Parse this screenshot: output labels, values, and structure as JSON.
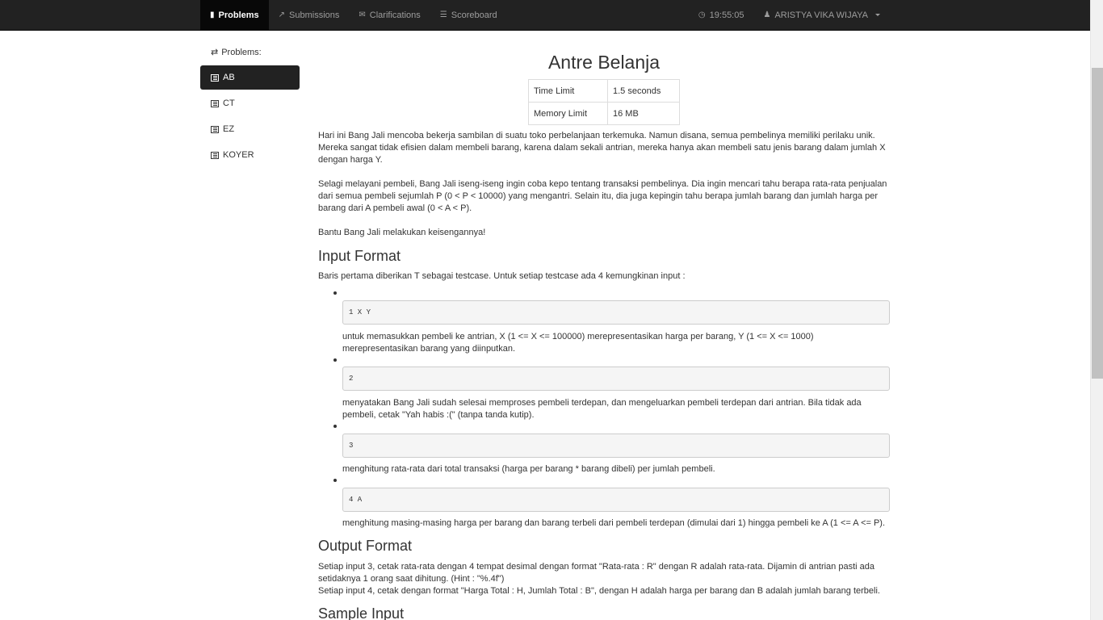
{
  "nav": {
    "items": [
      {
        "label": "Problems",
        "icon": "book-icon"
      },
      {
        "label": "Submissions",
        "icon": "share-icon"
      },
      {
        "label": "Clarifications",
        "icon": "envelope-icon"
      },
      {
        "label": "Scoreboard",
        "icon": "list-icon"
      }
    ],
    "clock": "19:55:05",
    "user": "ARISTYA VIKA WIJAYA"
  },
  "sidebar": {
    "heading": "Problems:",
    "items": [
      "AB",
      "CT",
      "EZ",
      "KOYER"
    ]
  },
  "problem": {
    "title": "Antre Belanja",
    "limits": [
      {
        "label": "Time Limit",
        "value": "1.5 seconds"
      },
      {
        "label": "Memory Limit",
        "value": "16 MB"
      }
    ],
    "p1": "Hari ini Bang Jali mencoba bekerja sambilan di suatu toko perbelanjaan terkemuka. Namun disana, semua pembelinya memiliki perilaku unik. Mereka sangat tidak efisien dalam membeli barang, karena dalam sekali antrian, mereka hanya akan membeli satu jenis barang dalam jumlah X dengan harga Y.",
    "p2": "Selagi melayani pembeli, Bang Jali iseng-iseng ingin coba kepo tentang transaksi pembelinya. Dia ingin mencari tahu berapa rata-rata penjualan dari semua pembeli sejumlah P (0 < P < 10000) yang mengantri. Selain itu, dia juga kepingin tahu berapa jumlah barang dan jumlah harga per barang dari A pembeli awal (0 < A < P).",
    "p3": "Bantu Bang Jali melakukan keisengannya!",
    "input_heading": "Input Format",
    "input_intro": "Baris pertama diberikan T sebagai testcase. Untuk setiap testcase ada 4 kemungkinan input :",
    "cases": [
      {
        "code": "1 X Y",
        "desc": "untuk memasukkan pembeli ke antrian, X (1 <= X <= 100000) merepresentasikan harga per barang, Y (1 <= X <= 1000) merepresentasikan barang yang diinputkan."
      },
      {
        "code": "2",
        "desc": "menyatakan Bang Jali sudah selesai memproses pembeli terdepan, dan mengeluarkan pembeli terdepan dari antrian. Bila tidak ada pembeli, cetak \"Yah habis :(\" (tanpa tanda kutip)."
      },
      {
        "code": "3",
        "desc": "menghitung rata-rata dari total transaksi (harga per barang * barang dibeli) per jumlah pembeli."
      },
      {
        "code": "4 A",
        "desc": "menghitung masing-masing harga per barang dan barang terbeli dari pembeli terdepan (dimulai dari 1) hingga pembeli ke A (1 <= A <= P)."
      }
    ],
    "output_heading": "Output Format",
    "output_p1": "Setiap input 3, cetak rata-rata dengan 4 tempat desimal dengan format \"Rata-rata : R\" dengan R adalah rata-rata. Dijamin di antrian pasti ada setidaknya 1 orang saat dihitung. (Hint : \"%.4f\")",
    "output_p2": "Setiap input 4, cetak dengan format \"Harga Total : H, Jumlah Total : B\", dengan H adalah harga per barang dan B adalah jumlah barang terbeli.",
    "sample_heading": "Sample Input"
  }
}
